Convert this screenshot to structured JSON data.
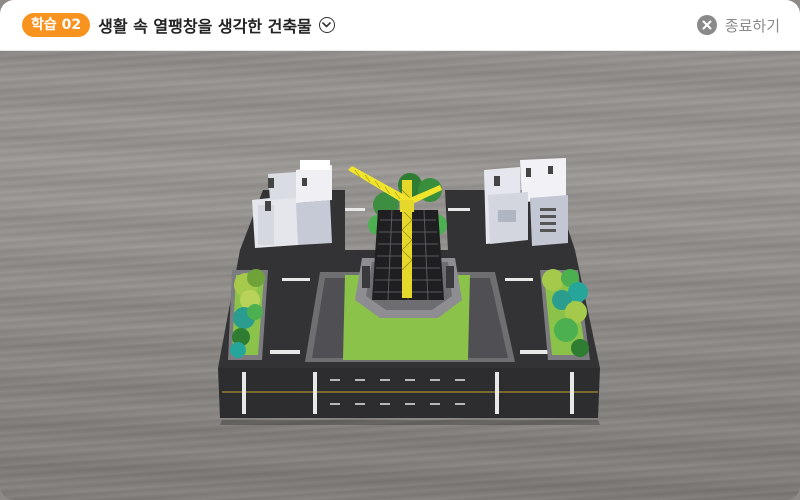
{
  "header": {
    "badge": "학습 02",
    "title": "생활 속 열팽창을 생각한 건축물",
    "exit_label": "종료하기"
  },
  "icons": {
    "title_toggle": "chevron-down-circle-icon",
    "exit": "close-circle-icon"
  },
  "colors": {
    "badge": "#f7931e",
    "exit": "#8a8a8a"
  },
  "scene": {
    "description_objects": [
      "ar-city-block-model",
      "construction-crane",
      "tower-under-construction",
      "buildings",
      "trees",
      "roads"
    ]
  }
}
